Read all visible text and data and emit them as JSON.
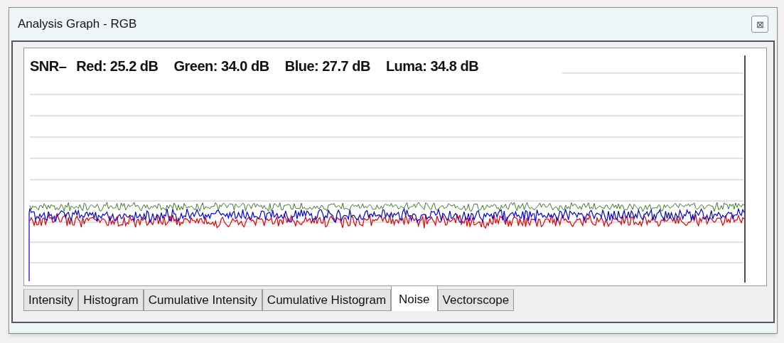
{
  "window": {
    "title": "Analysis Graph - RGB",
    "close_button": "⊠"
  },
  "snr": {
    "label": "SNR–",
    "readings": [
      {
        "text": "Red: 25.2 dB"
      },
      {
        "text": "Green: 34.0 dB"
      },
      {
        "text": "Blue: 27.7 dB"
      },
      {
        "text": "Luma: 34.8 dB"
      }
    ]
  },
  "tabs": [
    {
      "label": "Intensity",
      "selected": false
    },
    {
      "label": "Histogram",
      "selected": false
    },
    {
      "label": "Cumulative Intensity",
      "selected": false
    },
    {
      "label": "Cumulative Histogram",
      "selected": false
    },
    {
      "label": "Noise",
      "selected": true
    },
    {
      "label": "Vectorscope",
      "selected": false
    }
  ]
}
